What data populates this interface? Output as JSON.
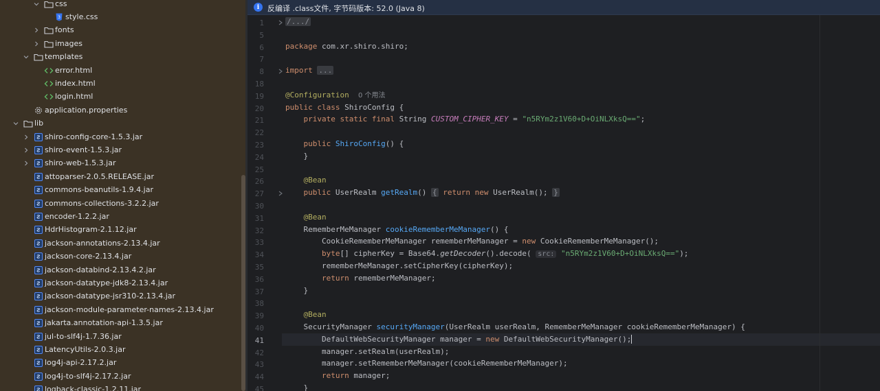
{
  "project_tree": {
    "items": [
      {
        "label": "css",
        "type": "folder",
        "depth": 3,
        "expanded": true
      },
      {
        "label": "style.css",
        "type": "css",
        "depth": 4
      },
      {
        "label": "fonts",
        "type": "folder",
        "depth": 3,
        "expanded": false
      },
      {
        "label": "images",
        "type": "folder",
        "depth": 3,
        "expanded": false
      },
      {
        "label": "templates",
        "type": "folder",
        "depth": 2,
        "expanded": true
      },
      {
        "label": "error.html",
        "type": "html",
        "depth": 3
      },
      {
        "label": "index.html",
        "type": "html",
        "depth": 3
      },
      {
        "label": "login.html",
        "type": "html",
        "depth": 3
      },
      {
        "label": "application.properties",
        "type": "properties",
        "depth": 2
      },
      {
        "label": "lib",
        "type": "folder",
        "depth": 1,
        "expanded": true
      },
      {
        "label": "shiro-config-core-1.5.3.jar",
        "type": "jar",
        "depth": 2,
        "expandable": true
      },
      {
        "label": "shiro-event-1.5.3.jar",
        "type": "jar",
        "depth": 2,
        "expandable": true
      },
      {
        "label": "shiro-web-1.5.3.jar",
        "type": "jar",
        "depth": 2,
        "expandable": true
      },
      {
        "label": "attoparser-2.0.5.RELEASE.jar",
        "type": "jar",
        "depth": 2
      },
      {
        "label": "commons-beanutils-1.9.4.jar",
        "type": "jar",
        "depth": 2
      },
      {
        "label": "commons-collections-3.2.2.jar",
        "type": "jar",
        "depth": 2
      },
      {
        "label": "encoder-1.2.2.jar",
        "type": "jar",
        "depth": 2
      },
      {
        "label": "HdrHistogram-2.1.12.jar",
        "type": "jar",
        "depth": 2
      },
      {
        "label": "jackson-annotations-2.13.4.jar",
        "type": "jar",
        "depth": 2
      },
      {
        "label": "jackson-core-2.13.4.jar",
        "type": "jar",
        "depth": 2
      },
      {
        "label": "jackson-databind-2.13.4.2.jar",
        "type": "jar",
        "depth": 2
      },
      {
        "label": "jackson-datatype-jdk8-2.13.4.jar",
        "type": "jar",
        "depth": 2
      },
      {
        "label": "jackson-datatype-jsr310-2.13.4.jar",
        "type": "jar",
        "depth": 2
      },
      {
        "label": "jackson-module-parameter-names-2.13.4.jar",
        "type": "jar",
        "depth": 2
      },
      {
        "label": "jakarta.annotation-api-1.3.5.jar",
        "type": "jar",
        "depth": 2
      },
      {
        "label": "jul-to-slf4j-1.7.36.jar",
        "type": "jar",
        "depth": 2
      },
      {
        "label": "LatencyUtils-2.0.3.jar",
        "type": "jar",
        "depth": 2
      },
      {
        "label": "log4j-api-2.17.2.jar",
        "type": "jar",
        "depth": 2
      },
      {
        "label": "log4j-to-slf4j-2.17.2.jar",
        "type": "jar",
        "depth": 2
      },
      {
        "label": "logback-classic-1.2.11.jar",
        "type": "jar",
        "depth": 2
      }
    ]
  },
  "editor": {
    "banner": {
      "icon": "info-icon",
      "text": "反编译 .class文件, 字节码版本: 52.0 (Java 8)"
    },
    "current_line": "41",
    "lines": [
      {
        "n": "1",
        "fold": true,
        "tokens": [
          {
            "t": "/.../",
            "c": "fd"
          }
        ]
      },
      {
        "n": "5",
        "tokens": []
      },
      {
        "n": "6",
        "tokens": [
          {
            "t": "package",
            "c": "kw"
          },
          {
            "t": " com.xr.shiro.shiro;"
          }
        ]
      },
      {
        "n": "7",
        "tokens": []
      },
      {
        "n": "8",
        "fold": true,
        "tokens": [
          {
            "t": "import",
            "c": "kw"
          },
          {
            "t": " "
          },
          {
            "t": "...",
            "c": "fd"
          }
        ]
      },
      {
        "n": "18",
        "tokens": []
      },
      {
        "n": "19",
        "tokens": [
          {
            "t": "@Configuration",
            "c": "an"
          },
          {
            "t": "  "
          },
          {
            "t": "0 个用法",
            "c": "hint"
          }
        ]
      },
      {
        "n": "20",
        "tokens": [
          {
            "t": "public",
            "c": "kw"
          },
          {
            "t": " "
          },
          {
            "t": "class",
            "c": "kw"
          },
          {
            "t": " ShiroConfig {"
          }
        ]
      },
      {
        "n": "21",
        "tokens": [
          {
            "t": "    "
          },
          {
            "t": "private",
            "c": "kw"
          },
          {
            "t": " "
          },
          {
            "t": "static",
            "c": "kw"
          },
          {
            "t": " "
          },
          {
            "t": "final",
            "c": "kw"
          },
          {
            "t": " String "
          },
          {
            "t": "CUSTOM_CIPHER_KEY",
            "c": "cst"
          },
          {
            "t": " = "
          },
          {
            "t": "\"n5RYm2z1V60+D+OiNLXksQ==\"",
            "c": "str"
          },
          {
            "t": ";"
          }
        ]
      },
      {
        "n": "22",
        "tokens": []
      },
      {
        "n": "23",
        "tokens": [
          {
            "t": "    "
          },
          {
            "t": "public",
            "c": "kw"
          },
          {
            "t": " "
          },
          {
            "t": "ShiroConfig",
            "c": "fn"
          },
          {
            "t": "() {"
          }
        ]
      },
      {
        "n": "24",
        "tokens": [
          {
            "t": "    }"
          }
        ]
      },
      {
        "n": "25",
        "tokens": []
      },
      {
        "n": "26",
        "tokens": [
          {
            "t": "    "
          },
          {
            "t": "@Bean",
            "c": "an"
          }
        ]
      },
      {
        "n": "27",
        "fold": true,
        "tokens": [
          {
            "t": "    "
          },
          {
            "t": "public",
            "c": "kw"
          },
          {
            "t": " UserRealm "
          },
          {
            "t": "getRealm",
            "c": "fn"
          },
          {
            "t": "() "
          },
          {
            "t": "{",
            "c": "fd"
          },
          {
            "t": " "
          },
          {
            "t": "return",
            "c": "kw"
          },
          {
            "t": " "
          },
          {
            "t": "new",
            "c": "kw"
          },
          {
            "t": " UserRealm(); "
          },
          {
            "t": "}",
            "c": "fd"
          }
        ]
      },
      {
        "n": "30",
        "tokens": []
      },
      {
        "n": "31",
        "tokens": [
          {
            "t": "    "
          },
          {
            "t": "@Bean",
            "c": "an"
          }
        ]
      },
      {
        "n": "32",
        "tokens": [
          {
            "t": "    RememberMeManager "
          },
          {
            "t": "cookieRememberMeManager",
            "c": "fn"
          },
          {
            "t": "() {"
          }
        ]
      },
      {
        "n": "33",
        "tokens": [
          {
            "t": "        CookieRememberMeManager rememberMeManager = "
          },
          {
            "t": "new",
            "c": "kw"
          },
          {
            "t": " CookieRememberMeManager();"
          }
        ]
      },
      {
        "n": "34",
        "tokens": [
          {
            "t": "        "
          },
          {
            "t": "byte",
            "c": "kw"
          },
          {
            "t": "[] cipherKey = Base64."
          },
          {
            "t": "getDecoder",
            "c": "ita"
          },
          {
            "t": "().decode( "
          },
          {
            "t": "src:",
            "c": "chip"
          },
          {
            "t": " "
          },
          {
            "t": "\"n5RYm2z1V60+D+OiNLXksQ==\"",
            "c": "str"
          },
          {
            "t": ");"
          }
        ]
      },
      {
        "n": "35",
        "tokens": [
          {
            "t": "        rememberMeManager.setCipherKey(cipherKey);"
          }
        ]
      },
      {
        "n": "36",
        "tokens": [
          {
            "t": "        "
          },
          {
            "t": "return",
            "c": "kw"
          },
          {
            "t": " rememberMeManager;"
          }
        ]
      },
      {
        "n": "37",
        "tokens": [
          {
            "t": "    }"
          }
        ]
      },
      {
        "n": "38",
        "tokens": []
      },
      {
        "n": "39",
        "tokens": [
          {
            "t": "    "
          },
          {
            "t": "@Bean",
            "c": "an"
          }
        ]
      },
      {
        "n": "40",
        "tokens": [
          {
            "t": "    SecurityManager "
          },
          {
            "t": "securityManager",
            "c": "fn"
          },
          {
            "t": "(UserRealm userRealm, RememberMeManager cookieRememberMeManager) {"
          }
        ]
      },
      {
        "n": "41",
        "caret": true,
        "tokens": [
          {
            "t": "        DefaultWebSecurityManager manager = "
          },
          {
            "t": "new",
            "c": "kw"
          },
          {
            "t": " DefaultWebSecurityManager();"
          }
        ]
      },
      {
        "n": "42",
        "tokens": [
          {
            "t": "        manager.setRealm(userRealm);"
          }
        ]
      },
      {
        "n": "43",
        "tokens": [
          {
            "t": "        manager.setRememberMeManager(cookieRememberMeManager);"
          }
        ]
      },
      {
        "n": "44",
        "tokens": [
          {
            "t": "        "
          },
          {
            "t": "return",
            "c": "kw"
          },
          {
            "t": " manager;"
          }
        ]
      },
      {
        "n": "45",
        "tokens": [
          {
            "t": "    }"
          }
        ]
      }
    ]
  }
}
